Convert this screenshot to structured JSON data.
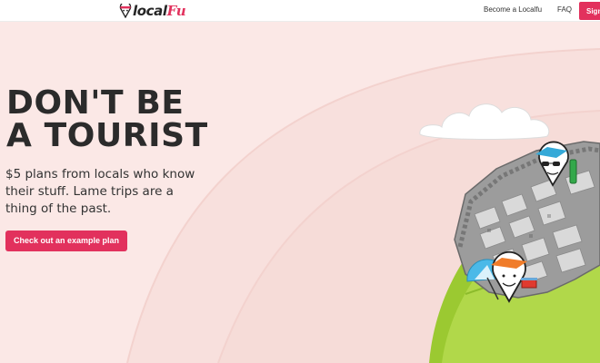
{
  "brand": {
    "name_part1": "local",
    "name_part2": "Fu",
    "accent_color": "#e2315d"
  },
  "nav": {
    "become_label": "Become a Localfu",
    "faq_label": "FAQ",
    "signin_label": "Sign"
  },
  "hero": {
    "title_line1": "DON'T BE",
    "title_line2": "A TOURIST",
    "subtitle": "$5 plans from locals who know their stuff. Lame trips are a thing of the past.",
    "cta_label": "Check out an example plan"
  },
  "icons": [
    "localfu-logo-icon",
    "cloud",
    "city-blocks",
    "globe-hill",
    "pin-mascot-sunglasses",
    "pin-mascot-bandana",
    "beach-umbrella"
  ]
}
